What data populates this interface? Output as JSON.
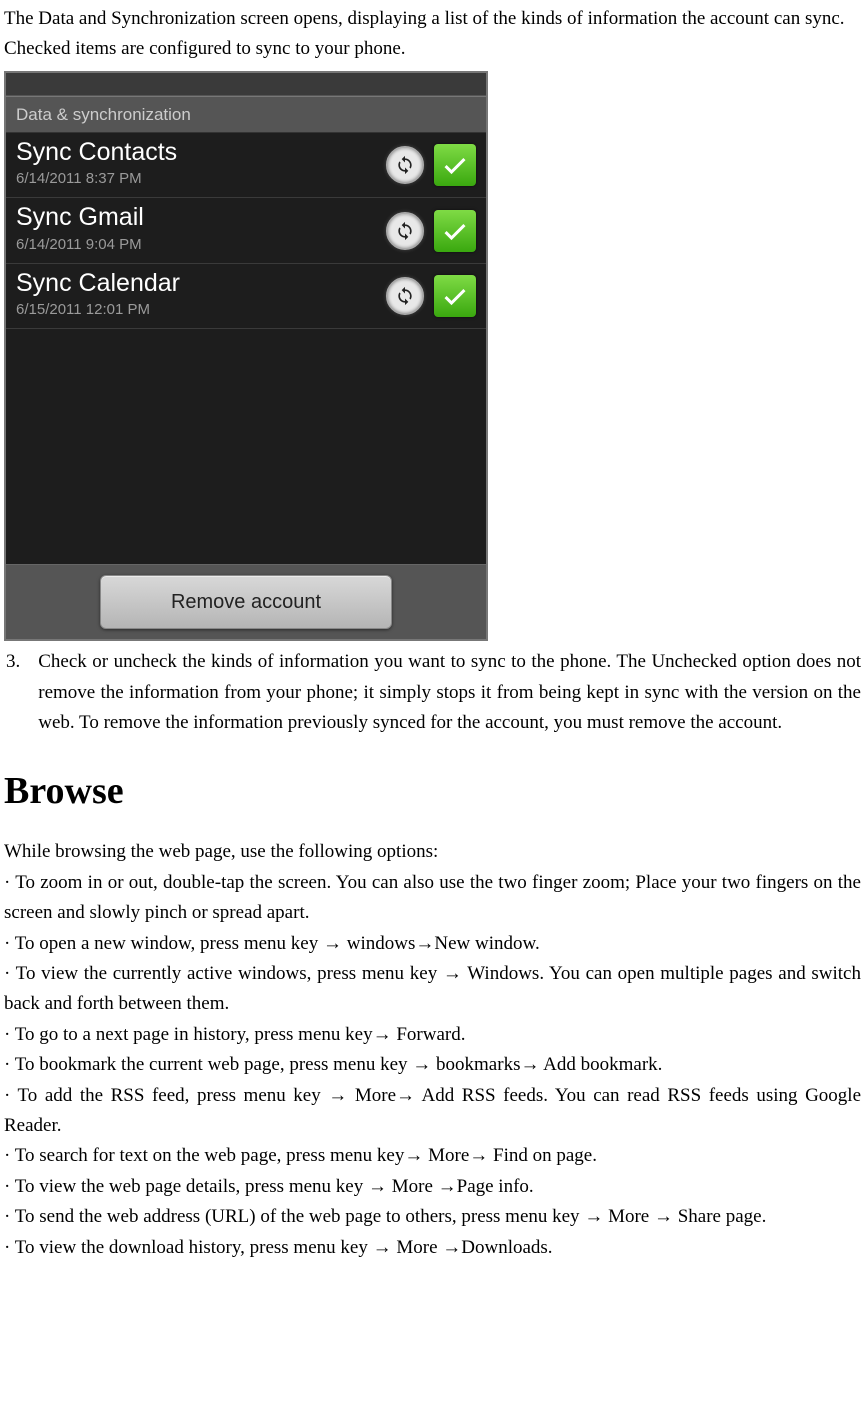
{
  "intro": {
    "p1": "The Data and Synchronization screen opens, displaying a list of the kinds of information the account can sync.",
    "p2": "Checked items are configured to sync to your phone."
  },
  "screen": {
    "header": "Data & synchronization",
    "rows": [
      {
        "title": "Sync Contacts",
        "time": "6/14/2011 8:37 PM"
      },
      {
        "title": "Sync Gmail",
        "time": "6/14/2011 9:04 PM"
      },
      {
        "title": "Sync Calendar",
        "time": "6/15/2011 12:01 PM"
      }
    ],
    "remove_btn": "Remove account"
  },
  "step3": {
    "num": "3.",
    "text": "Check or uncheck the kinds of information you want to sync to the phone. The Unchecked option does not remove the information from your phone; it simply stops it from being kept in sync with the version on the web. To remove the information previously synced for the account, you must remove the account."
  },
  "browse": {
    "heading": "Browse",
    "intro": "While browsing the web page, use the following options:",
    "b1": "· To zoom in or out, double-tap the screen. You can also use the two finger zoom; Place your two fingers on the screen and slowly pinch or spread apart.",
    "b2a": "· To open a new window, press menu key ",
    "b2b": " windows",
    "b2c": "New window.",
    "b3a": "· To view the currently active windows, press menu key ",
    "b3b": " Windows. You can open multiple pages and switch back and forth between them.",
    "b4a": "· To go to a next page in history, press menu key",
    "b4b": " Forward.",
    "b5a": "· To bookmark the current web page, press menu key ",
    "b5b": " bookmarks",
    "b5c": " Add bookmark.",
    "b6a": "· To add the RSS feed, press menu key ",
    "b6b": " More",
    "b6c": " Add RSS feeds. You can read RSS feeds using Google Reader.",
    "b7a": "· To search for text on the web page, press menu key",
    "b7b": " More",
    "b7c": " Find on page.",
    "b8a": "· To view the web page details, press menu key ",
    "b8b": " More ",
    "b8c": "Page info.",
    "b9a": "· To send the web address (URL) of the web page to others, press menu key ",
    "b9b": " More ",
    "b9c": " Share page.",
    "b10a": "· To view the download history, press menu key ",
    "b10b": " More ",
    "b10c": "Downloads."
  },
  "arrow": "→"
}
